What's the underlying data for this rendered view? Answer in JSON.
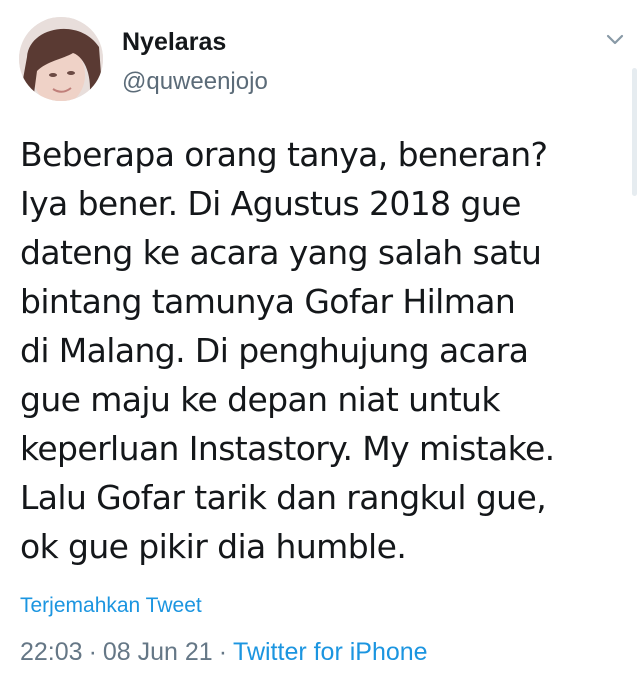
{
  "tweet": {
    "author": {
      "display_name": "Nyelaras",
      "handle": "@quweenjojo"
    },
    "text": "Beberapa orang tanya, beneran?\nIya bener. Di Agustus 2018 gue\ndateng ke acara yang salah satu\nbintang tamunya Gofar Hilman\ndi Malang. Di penghujung acara\ngue maju ke depan niat untuk\nkeperluan Instastory. My mistake.\nLalu Gofar tarik dan rangkul gue,\nok gue pikir dia humble.",
    "translate_label": "Terjemahkan Tweet",
    "time": "22:03",
    "separator": "·",
    "date": "08 Jun 21",
    "source": "Twitter for iPhone"
  },
  "icons": {
    "menu": "chevron-down-icon",
    "avatar": "avatar"
  },
  "colors": {
    "link": "#1b95e0",
    "secondary_text": "#657786",
    "primary_text": "#14171a"
  }
}
